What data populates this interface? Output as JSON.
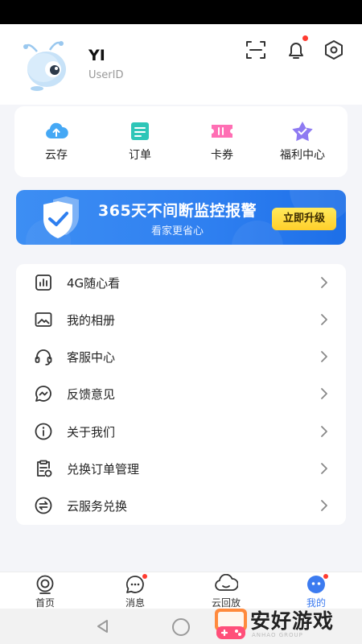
{
  "profile": {
    "name": "YI",
    "user_id_label": "UserID",
    "icons": [
      "scan-icon",
      "bell-icon",
      "settings-icon"
    ]
  },
  "quick_actions": [
    {
      "label": "云存",
      "icon": "cloud-upload-icon",
      "color": "#45a8f5"
    },
    {
      "label": "订单",
      "icon": "order-icon",
      "color": "#2ec6b8"
    },
    {
      "label": "卡券",
      "icon": "coupon-icon",
      "color": "#ff6fb4"
    },
    {
      "label": "福利中心",
      "icon": "star-badge-icon",
      "color": "#8e7af2"
    }
  ],
  "banner": {
    "title": "365天不间断监控报警",
    "subtitle": "看家更省心",
    "button": "立即升级"
  },
  "menu": [
    {
      "label": "4G随心看",
      "icon": "sim-card-icon"
    },
    {
      "label": "我的相册",
      "icon": "album-icon"
    },
    {
      "label": "客服中心",
      "icon": "headset-icon"
    },
    {
      "label": "反馈意见",
      "icon": "feedback-icon"
    },
    {
      "label": "关于我们",
      "icon": "info-icon"
    },
    {
      "label": "兑换订单管理",
      "icon": "clipboard-icon"
    },
    {
      "label": "云服务兑换",
      "icon": "exchange-icon"
    }
  ],
  "tabbar": [
    {
      "label": "首页",
      "icon": "camera-icon",
      "active": false
    },
    {
      "label": "消息",
      "icon": "message-icon",
      "active": false,
      "dot": true
    },
    {
      "label": "云回放",
      "icon": "cloud-playback-icon",
      "active": false
    },
    {
      "label": "我的",
      "icon": "robot-face-icon",
      "active": true,
      "dot": true
    }
  ],
  "watermark": {
    "text": "安好游戏",
    "sub": "ANHAO GROUP"
  },
  "colors": {
    "accent": "#3c7bf0",
    "banner": "#2e7ff0",
    "upgrade_button": "#ffd93a",
    "badge": "#ff3b30"
  }
}
